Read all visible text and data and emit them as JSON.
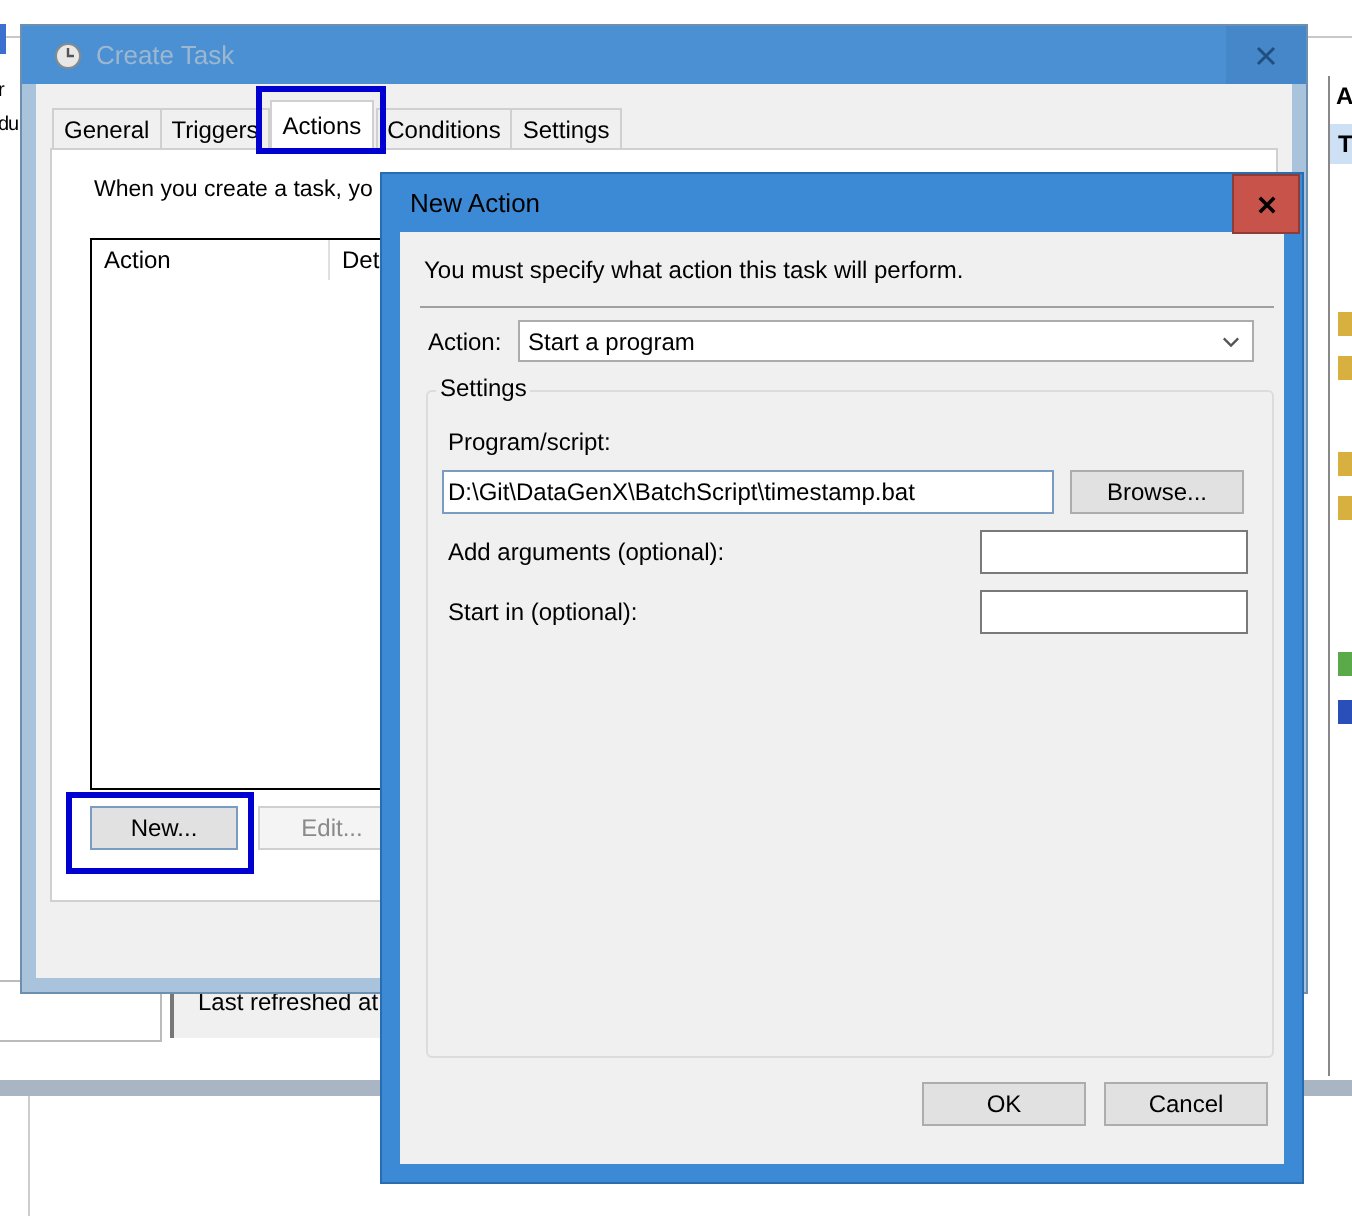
{
  "background_app": {
    "left_texts": [
      "r",
      "du"
    ],
    "status_text": "Last refreshed at",
    "right_header": "A",
    "right_row": "T"
  },
  "create_task": {
    "title": "Create Task",
    "tabs": [
      {
        "label": "General",
        "selected": false,
        "highlighted": false
      },
      {
        "label": "Triggers",
        "selected": false,
        "highlighted": false
      },
      {
        "label": "Actions",
        "selected": true,
        "highlighted": true
      },
      {
        "label": "Conditions",
        "selected": false,
        "highlighted": false
      },
      {
        "label": "Settings",
        "selected": false,
        "highlighted": false
      }
    ],
    "intro": "When you create a task, yo",
    "list_columns": [
      "Action",
      "Det"
    ],
    "buttons": [
      {
        "label": "New...",
        "disabled": false,
        "highlighted": true
      },
      {
        "label": "Edit...",
        "disabled": true,
        "highlighted": false
      }
    ]
  },
  "new_action": {
    "title": "New Action",
    "instruction": "You must specify what action this task will perform.",
    "action_label": "Action:",
    "action_value": "Start a program",
    "group_label": "Settings",
    "fields": [
      {
        "kind": "stacked",
        "label": "Program/script:",
        "value": "D:\\Git\\DataGenX\\BatchScript\\timestamp.bat",
        "button": "Browse..."
      },
      {
        "kind": "inline",
        "label": "Add arguments (optional):"
      },
      {
        "kind": "inline",
        "label": "Start in (optional):"
      }
    ],
    "buttons": [
      "OK",
      "Cancel"
    ]
  }
}
